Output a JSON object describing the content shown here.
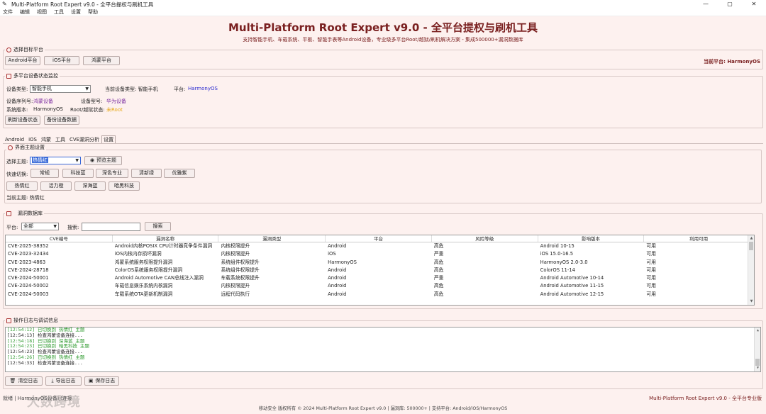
{
  "window": {
    "title": "Multi-Platform Root Expert v9.0 - 全平台提权与刷机工具",
    "controls": [
      "—",
      "▢",
      "✕"
    ]
  },
  "menu": [
    "文件",
    "编辑",
    "视图",
    "工具",
    "设置",
    "帮助"
  ],
  "header": {
    "title": "Multi-Platform Root Expert v9.0 - 全平台提权与刷机工具",
    "subtitle": "支持智能手机、车载系统、平板、智能手表等Android设备，专业级多平台Root/越狱/刷机解决方案 - 集成500000+漏洞数据库"
  },
  "platform_select": {
    "group_label": "选择目标平台",
    "buttons": [
      "Android平台",
      "iOS平台",
      "鸿蒙平台"
    ],
    "current_label": "当前平台: HarmonyOS"
  },
  "device_monitor": {
    "group_label": "多平台设备状态监控",
    "device_type_label": "设备类型:",
    "device_type_value": "智能手机",
    "current_type_label": "当前设备类型: 智能手机",
    "platform_label": "平台:",
    "platform_value": "HarmonyOS",
    "serial_label": "设备序列号:",
    "serial_value": "鸿蒙设备",
    "model_label": "设备型号:",
    "model_value": "华为设备",
    "sysver_label": "系统版本:",
    "sysver_value": "HarmonyOS",
    "root_label": "Root/越狱状态:",
    "root_value": "未Root",
    "buttons": [
      "刷新设备状态",
      "备份设备数据"
    ]
  },
  "tabs": [
    "Android",
    "iOS",
    "鸿蒙",
    "工具",
    "CVE漏洞分析",
    "设置"
  ],
  "active_tab": 5,
  "theme": {
    "group_label": "界面主题设置",
    "select_label": "选择主题:",
    "select_value": "热情红",
    "preview_button": "预览主题",
    "quick_label": "快速切换:",
    "quick_row1": [
      "常规",
      "科技蓝",
      "深色专业",
      "清新绿",
      "优雅紫"
    ],
    "quick_row2": [
      "热情红",
      "活力橙",
      "深海蓝",
      "暗黑科技"
    ],
    "current_label": "当前主题: 热情红"
  },
  "vuln_db": {
    "group_label": "漏洞数据库",
    "platform_label": "平台:",
    "platform_value": "全部",
    "search_label": "搜索:",
    "search_value": "",
    "search_button": "搜索",
    "columns": [
      "CVE编号",
      "漏洞名称",
      "漏洞类型",
      "平台",
      "风险等级",
      "影响版本",
      "利用可用"
    ],
    "rows": [
      [
        "CVE-2025-38352",
        "Android内核POSIX CPU计时器竞争条件漏洞",
        "内核权限提升",
        "Android",
        "高危",
        "Android 10-15",
        "可用"
      ],
      [
        "CVE-2023-32434",
        "iOS内核内存损坏漏洞",
        "内核权限提升",
        "iOS",
        "严重",
        "iOS 15.0-16.5",
        "可用"
      ],
      [
        "CVE-2023-4863",
        "鸿蒙系统服务权限提升漏洞",
        "系统组件权限提升",
        "HarmonyOS",
        "高危",
        "HarmonyOS 2.0-3.0",
        "可用"
      ],
      [
        "CVE-2024-28718",
        "ColorOS系统服务权限提升漏洞",
        "系统组件权限提升",
        "Android",
        "高危",
        "ColorOS 11-14",
        "可用"
      ],
      [
        "CVE-2024-50001",
        "Android Automotive CAN总线注入漏洞",
        "车载系统权限提升",
        "Android",
        "严重",
        "Android Automotive 10-14",
        "可用"
      ],
      [
        "CVE-2024-50002",
        "车载信息娱乐系统内核漏洞",
        "内核权限提升",
        "Android",
        "高危",
        "Android Automotive 11-15",
        "可用"
      ],
      [
        "CVE-2024-50003",
        "车载系统OTA更新机制漏洞",
        "远程代码执行",
        "Android",
        "高危",
        "Android Automotive 12-15",
        "可用"
      ]
    ]
  },
  "log": {
    "group_label": "操作日志与调试信息",
    "lines": [
      {
        "text": "[12:54:12] 已切换到 热情红 主题",
        "color": "#2e9a2e"
      },
      {
        "text": "[12:54:13] 检查鸿蒙设备连接...",
        "color": "#222222"
      },
      {
        "text": "[12:54:18] 已切换到 深海蓝 主题",
        "color": "#2e9a2e"
      },
      {
        "text": "[12:54:23] 已切换到 暗黑科技 主题",
        "color": "#2e9a2e"
      },
      {
        "text": "[12:54:23] 检查鸿蒙设备连接...",
        "color": "#222222"
      },
      {
        "text": "[12:54:26] 已切换到 热情红 主题",
        "color": "#2e9a2e"
      },
      {
        "text": "[12:54:33] 检查鸿蒙设备连接...",
        "color": "#222222"
      }
    ],
    "buttons": [
      "清空日志",
      "导出日志",
      "保存日志"
    ]
  },
  "footer": {
    "status": "就绪 | HarmonyOS设备已连接",
    "right": "Multi-Platform Root Expert v9.0 - 全平台专业版",
    "copyright": "移动安全 版权所有 © 2024 Multi-Platform Root Expert v9.0 | 漏洞库: 500000+ | 支持平台: Android/iOS/HarmonyOS",
    "watermark": "大数跨境"
  },
  "colors": {
    "accent": "#7a2020",
    "background": "#fdf1ef",
    "blue_value": "#2a2ad0",
    "purple_value": "#7a2ca0",
    "root_warn": "#e6a817",
    "log_green": "#2e9a2e"
  }
}
